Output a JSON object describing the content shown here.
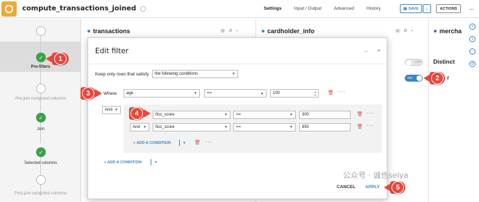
{
  "header": {
    "recipe_title": "compute_transactions_joined",
    "tabs": [
      "Settings",
      "Input / Output",
      "Advanced",
      "History"
    ],
    "save_label": "SAVE",
    "actions_label": "ACTIONS"
  },
  "sidebar": {
    "steps": [
      {
        "label": "Pre-filters",
        "state": "done",
        "active": true
      },
      {
        "label": "Pre-join computed columns",
        "state": "empty"
      },
      {
        "label": "Join",
        "state": "done"
      },
      {
        "label": "Selected columns",
        "state": "done"
      },
      {
        "label": "Post-join computed columns",
        "state": "empty"
      }
    ]
  },
  "datasets": {
    "left": "transactions",
    "middle": "cardholder_info",
    "right": "mercha"
  },
  "right_panel": {
    "distinct_label": "Distinct",
    "toggle_off": "OFF",
    "toggle_on": "ON",
    "partial_text": "r"
  },
  "modal": {
    "title": "Edit filter",
    "keep_label": "Keep only rows that satisfy",
    "mode_select": "the following conditions",
    "where_label": "Where",
    "outer_condition": {
      "column": "age",
      "operator": "<=",
      "value": "100"
    },
    "group_operator": "And",
    "inner_conditions": [
      {
        "column": "fico_score",
        "operator": ">=",
        "value": "300"
      },
      {
        "connector": "And",
        "column": "fico_score",
        "operator": "<=",
        "value": "850"
      }
    ],
    "add_condition_inner": "+ ADD A CONDITION",
    "add_condition_outer": "+ ADD A CONDITION",
    "cancel_label": "CANCEL",
    "apply_label": "APPLY"
  },
  "callouts": [
    "1",
    "2",
    "3",
    "4",
    "5"
  ],
  "watermark": "公众号 · 诚也seiya",
  "colors": {
    "accent": "#3c84c6",
    "success": "#3aa24a",
    "callout": "#e8473c",
    "danger": "#d9534f"
  }
}
